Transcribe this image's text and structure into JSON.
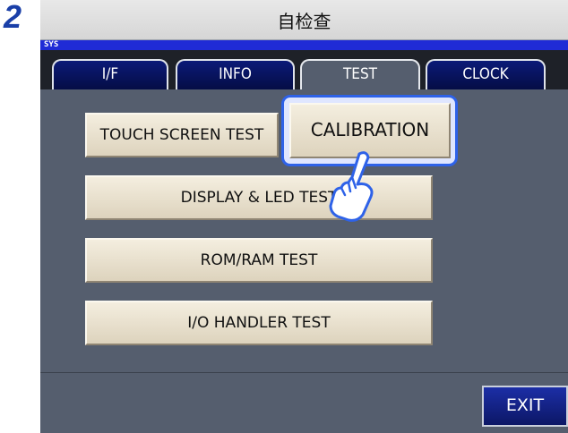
{
  "step": {
    "number": "2"
  },
  "window": {
    "title": "自检查",
    "mode_label": "SYS"
  },
  "tabs": [
    {
      "label": "I/F",
      "active": false
    },
    {
      "label": "INFO",
      "active": false
    },
    {
      "label": "TEST",
      "active": true
    },
    {
      "label": "CLOCK",
      "active": false
    }
  ],
  "test_buttons": {
    "touch_screen": "TOUCH SCREEN TEST",
    "calibration": "CALIBRATION",
    "display_led": "DISPLAY & LED TEST",
    "rom_ram": "ROM/RAM TEST",
    "io_handler": "I/O HANDLER TEST"
  },
  "footer": {
    "exit_label": "EXIT"
  },
  "colors": {
    "screen_bg": "#555e6e",
    "sys_bar": "#1f2bd6",
    "tab_bg": "#0b1a78",
    "button_face": "#ece4d0",
    "highlight": "#2e62e8",
    "exit_bg": "#142090"
  },
  "icons": {
    "pointer": "pointing-hand-icon"
  }
}
